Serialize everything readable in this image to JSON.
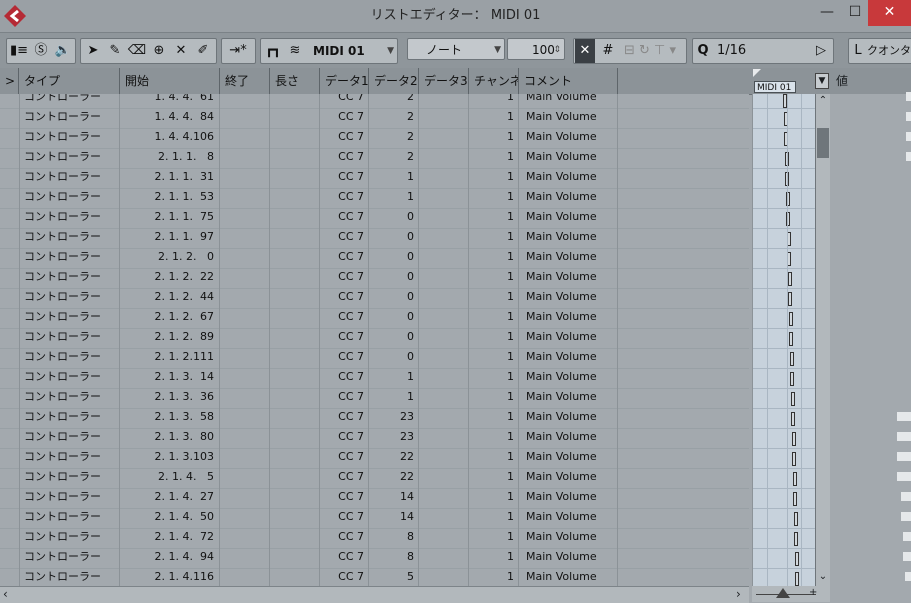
{
  "window": {
    "title": "リストエディター： MIDI 01",
    "minimize_glyph": "—",
    "maximize_glyph": "☐",
    "close_glyph": "✕"
  },
  "toolbar": {
    "part_name": "MIDI 01",
    "event_type": "ノート",
    "velocity": "100",
    "quantize_label": "Q",
    "quantize_value": "1/16",
    "length_label": "L",
    "length_value": "クオンタ"
  },
  "columns": [
    "タイプ",
    "開始",
    "終了",
    "長さ",
    "データ1",
    "データ2",
    "データ3",
    "チャンネル",
    "コメント"
  ],
  "value_header": "値",
  "clip_name": "MIDI 01",
  "rows": [
    {
      "type": "コントローラー",
      "start": "1. 4. 4.  61",
      "data1": "CC 7",
      "data2": "2",
      "channel": "1",
      "comment": "Main Volume"
    },
    {
      "type": "コントローラー",
      "start": "1. 4. 4.  84",
      "data1": "CC 7",
      "data2": "2",
      "channel": "1",
      "comment": "Main Volume"
    },
    {
      "type": "コントローラー",
      "start": "1. 4. 4.106",
      "data1": "CC 7",
      "data2": "2",
      "channel": "1",
      "comment": "Main Volume"
    },
    {
      "type": "コントローラー",
      "start": "2. 1. 1.   8",
      "data1": "CC 7",
      "data2": "2",
      "channel": "1",
      "comment": "Main Volume"
    },
    {
      "type": "コントローラー",
      "start": "2. 1. 1.  31",
      "data1": "CC 7",
      "data2": "1",
      "channel": "1",
      "comment": "Main Volume"
    },
    {
      "type": "コントローラー",
      "start": "2. 1. 1.  53",
      "data1": "CC 7",
      "data2": "1",
      "channel": "1",
      "comment": "Main Volume"
    },
    {
      "type": "コントローラー",
      "start": "2. 1. 1.  75",
      "data1": "CC 7",
      "data2": "0",
      "channel": "1",
      "comment": "Main Volume"
    },
    {
      "type": "コントローラー",
      "start": "2. 1. 1.  97",
      "data1": "CC 7",
      "data2": "0",
      "channel": "1",
      "comment": "Main Volume"
    },
    {
      "type": "コントローラー",
      "start": "2. 1. 2.   0",
      "data1": "CC 7",
      "data2": "0",
      "channel": "1",
      "comment": "Main Volume"
    },
    {
      "type": "コントローラー",
      "start": "2. 1. 2.  22",
      "data1": "CC 7",
      "data2": "0",
      "channel": "1",
      "comment": "Main Volume"
    },
    {
      "type": "コントローラー",
      "start": "2. 1. 2.  44",
      "data1": "CC 7",
      "data2": "0",
      "channel": "1",
      "comment": "Main Volume"
    },
    {
      "type": "コントローラー",
      "start": "2. 1. 2.  67",
      "data1": "CC 7",
      "data2": "0",
      "channel": "1",
      "comment": "Main Volume"
    },
    {
      "type": "コントローラー",
      "start": "2. 1. 2.  89",
      "data1": "CC 7",
      "data2": "0",
      "channel": "1",
      "comment": "Main Volume"
    },
    {
      "type": "コントローラー",
      "start": "2. 1. 2.111",
      "data1": "CC 7",
      "data2": "0",
      "channel": "1",
      "comment": "Main Volume"
    },
    {
      "type": "コントローラー",
      "start": "2. 1. 3.  14",
      "data1": "CC 7",
      "data2": "1",
      "channel": "1",
      "comment": "Main Volume"
    },
    {
      "type": "コントローラー",
      "start": "2. 1. 3.  36",
      "data1": "CC 7",
      "data2": "1",
      "channel": "1",
      "comment": "Main Volume"
    },
    {
      "type": "コントローラー",
      "start": "2. 1. 3.  58",
      "data1": "CC 7",
      "data2": "23",
      "channel": "1",
      "comment": "Main Volume"
    },
    {
      "type": "コントローラー",
      "start": "2. 1. 3.  80",
      "data1": "CC 7",
      "data2": "23",
      "channel": "1",
      "comment": "Main Volume"
    },
    {
      "type": "コントローラー",
      "start": "2. 1. 3.103",
      "data1": "CC 7",
      "data2": "22",
      "channel": "1",
      "comment": "Main Volume"
    },
    {
      "type": "コントローラー",
      "start": "2. 1. 4.   5",
      "data1": "CC 7",
      "data2": "22",
      "channel": "1",
      "comment": "Main Volume"
    },
    {
      "type": "コントローラー",
      "start": "2. 1. 4.  27",
      "data1": "CC 7",
      "data2": "14",
      "channel": "1",
      "comment": "Main Volume"
    },
    {
      "type": "コントローラー",
      "start": "2. 1. 4.  50",
      "data1": "CC 7",
      "data2": "14",
      "channel": "1",
      "comment": "Main Volume"
    },
    {
      "type": "コントローラー",
      "start": "2. 1. 4.  72",
      "data1": "CC 7",
      "data2": "8",
      "channel": "1",
      "comment": "Main Volume"
    },
    {
      "type": "コントローラー",
      "start": "2. 1. 4.  94",
      "data1": "CC 7",
      "data2": "8",
      "channel": "1",
      "comment": "Main Volume"
    },
    {
      "type": "コントローラー",
      "start": "2. 1. 4.116",
      "data1": "CC 7",
      "data2": "5",
      "channel": "1",
      "comment": "Main Volume"
    }
  ],
  "colors": {
    "accent": "#c8393b",
    "clip": "#c7d2dc"
  }
}
